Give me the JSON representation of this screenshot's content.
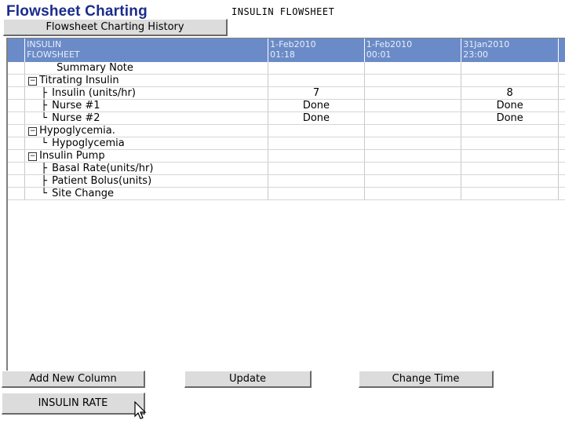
{
  "header": {
    "title": "Flowsheet Charting",
    "subtitle": "INSULIN FLOWSHEET",
    "history_button": "Flowsheet Charting History"
  },
  "grid": {
    "corner_label_line1": "INSULIN",
    "corner_label_line2": "FLOWSHEET",
    "columns": [
      {
        "date": "1-Feb2010",
        "time": "01:18"
      },
      {
        "date": "1-Feb2010",
        "time": "00:01"
      },
      {
        "date": "31Jan2010",
        "time": "23:00"
      }
    ],
    "rows": [
      {
        "label": "Summary Note",
        "kind": "item",
        "values": [
          "",
          "",
          ""
        ]
      },
      {
        "label": "Titrating Insulin",
        "kind": "group",
        "values": [
          "",
          "",
          ""
        ]
      },
      {
        "label": "Insulin (units/hr)",
        "kind": "child",
        "values": [
          "7",
          "",
          "8"
        ]
      },
      {
        "label": "Nurse #1",
        "kind": "child",
        "values": [
          "Done",
          "",
          "Done"
        ]
      },
      {
        "label": "Nurse #2",
        "kind": "last",
        "values": [
          "Done",
          "",
          "Done"
        ]
      },
      {
        "label": "Hypoglycemia.",
        "kind": "group",
        "values": [
          "",
          "",
          ""
        ]
      },
      {
        "label": "Hypoglycemia",
        "kind": "last",
        "values": [
          "",
          "",
          ""
        ]
      },
      {
        "label": "Insulin Pump",
        "kind": "group",
        "values": [
          "",
          "",
          ""
        ]
      },
      {
        "label": "Basal Rate(units/hr)",
        "kind": "child",
        "values": [
          "",
          "",
          ""
        ]
      },
      {
        "label": "Patient Bolus(units)",
        "kind": "child",
        "values": [
          "",
          "",
          ""
        ]
      },
      {
        "label": "Site Change",
        "kind": "last",
        "values": [
          "",
          "",
          ""
        ]
      }
    ]
  },
  "buttons": {
    "add_column": "Add New Column",
    "update": "Update",
    "change_time": "Change Time",
    "insulin_rate": "INSULIN RATE"
  },
  "colors": {
    "header_bg": "#6b8bc8",
    "title": "#1a2c8c",
    "button_bg": "#dcdcdc"
  }
}
